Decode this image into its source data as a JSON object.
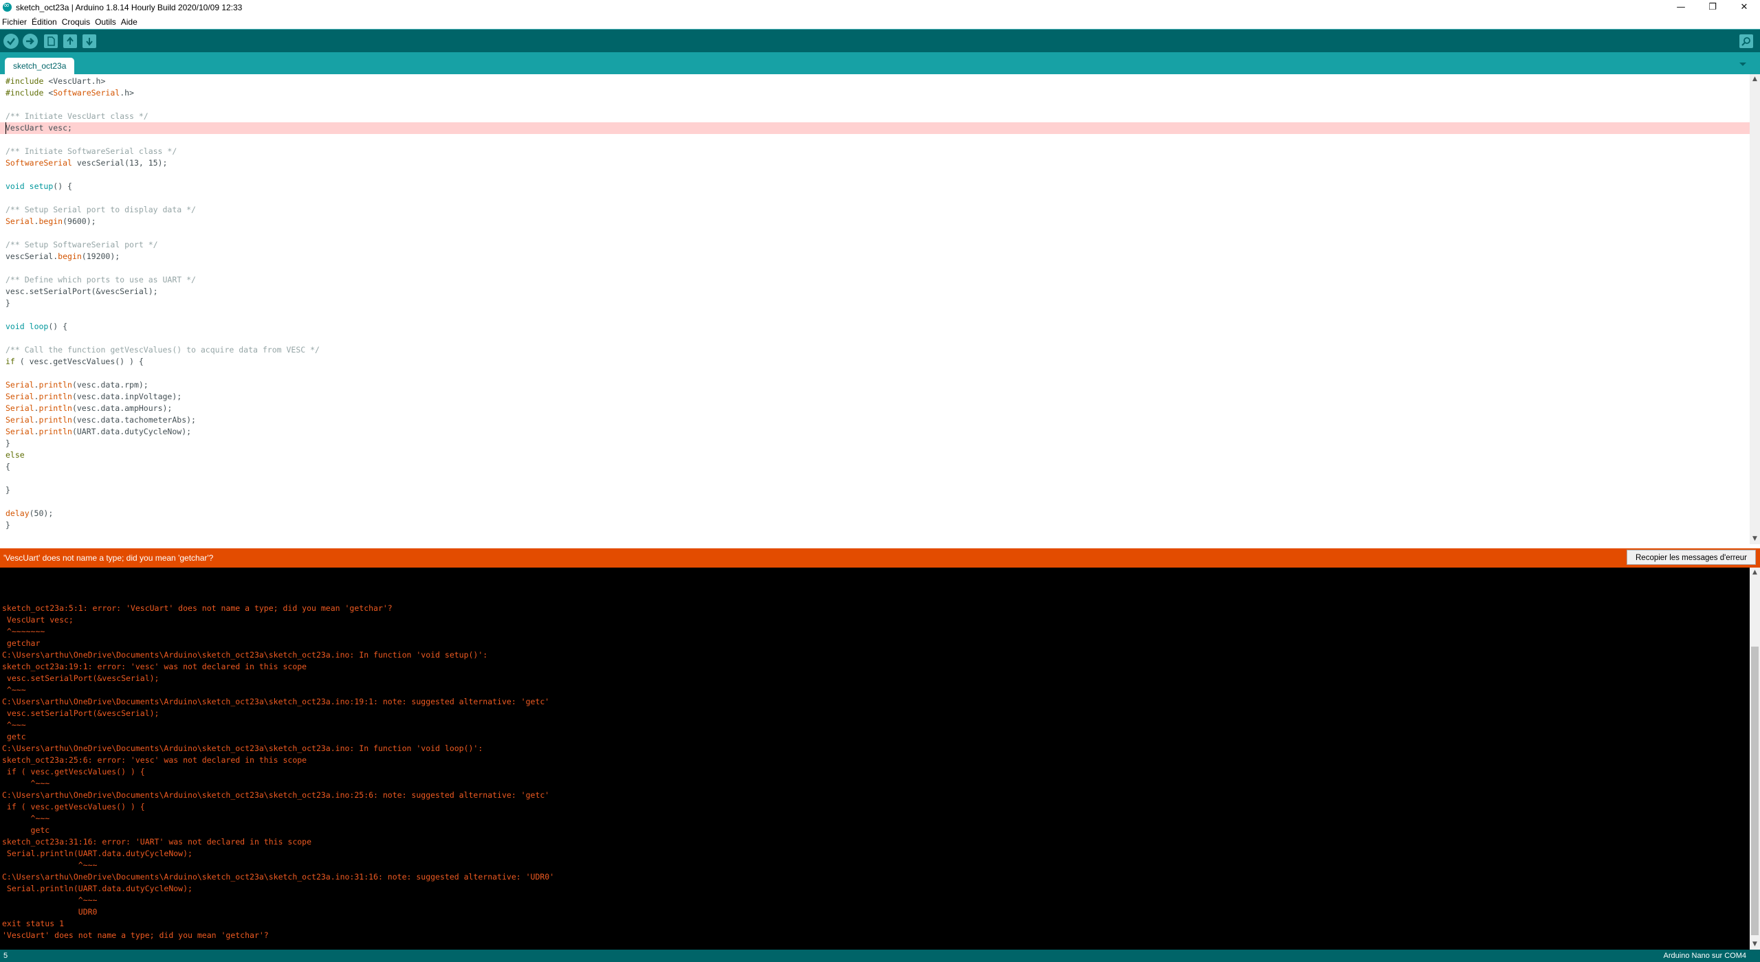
{
  "window": {
    "title": "sketch_oct23a | Arduino 1.8.14 Hourly Build 2020/10/09 12:33",
    "controls": [
      "—",
      "❐",
      "✕"
    ]
  },
  "menu": [
    "Fichier",
    "Édition",
    "Croquis",
    "Outils",
    "Aide"
  ],
  "toolbar": {
    "buttons": [
      "verify-icon",
      "upload-icon",
      "new-icon",
      "open-icon",
      "save-icon"
    ],
    "serial_monitor_icon": "magnifier-icon"
  },
  "tabs": [
    {
      "label": "sketch_oct23a"
    }
  ],
  "colors": {
    "toolbar": "#006468",
    "tabbar": "#17a1a5",
    "error_bar": "#e34c00",
    "console_text": "#ee5a21",
    "highlight": "#ffd1d1"
  },
  "editor": {
    "highlighted_line": 5,
    "lines": [
      {
        "segments": [
          {
            "t": "#include ",
            "c": "pre"
          },
          {
            "t": "<VescUart.h>",
            "c": "inc"
          }
        ]
      },
      {
        "segments": [
          {
            "t": "#include ",
            "c": "pre"
          },
          {
            "t": "<",
            "c": "inc"
          },
          {
            "t": "SoftwareSerial",
            "c": "type"
          },
          {
            "t": ".h>",
            "c": "inc"
          }
        ]
      },
      {
        "segments": []
      },
      {
        "segments": [
          {
            "t": "/** Initiate VescUart class */",
            "c": "com"
          }
        ]
      },
      {
        "segments": [
          {
            "t": "VescUart vesc;",
            "c": "txt"
          }
        ]
      },
      {
        "segments": []
      },
      {
        "segments": [
          {
            "t": "/** Initiate SoftwareSerial class */",
            "c": "com"
          }
        ]
      },
      {
        "segments": [
          {
            "t": "SoftwareSerial",
            "c": "type"
          },
          {
            "t": " vescSerial(13, 15);",
            "c": "txt"
          }
        ]
      },
      {
        "segments": []
      },
      {
        "segments": [
          {
            "t": "void",
            "c": "kw"
          },
          {
            "t": " ",
            "c": "txt"
          },
          {
            "t": "setup",
            "c": "kw"
          },
          {
            "t": "() {",
            "c": "txt"
          }
        ]
      },
      {
        "segments": []
      },
      {
        "segments": [
          {
            "t": "/** Setup Serial port to display data */",
            "c": "com"
          }
        ]
      },
      {
        "segments": [
          {
            "t": "Serial",
            "c": "type"
          },
          {
            "t": ".",
            "c": "txt"
          },
          {
            "t": "begin",
            "c": "type"
          },
          {
            "t": "(9600);",
            "c": "txt"
          }
        ]
      },
      {
        "segments": []
      },
      {
        "segments": [
          {
            "t": "/** Setup SoftwareSerial port */",
            "c": "com"
          }
        ]
      },
      {
        "segments": [
          {
            "t": "vescSerial.",
            "c": "txt"
          },
          {
            "t": "begin",
            "c": "type"
          },
          {
            "t": "(19200);",
            "c": "txt"
          }
        ]
      },
      {
        "segments": []
      },
      {
        "segments": [
          {
            "t": "/** Define which ports to use as UART */",
            "c": "com"
          }
        ]
      },
      {
        "segments": [
          {
            "t": "vesc.setSerialPort(&vescSerial);",
            "c": "txt"
          }
        ]
      },
      {
        "segments": [
          {
            "t": "}",
            "c": "txt"
          }
        ]
      },
      {
        "segments": []
      },
      {
        "segments": [
          {
            "t": "void",
            "c": "kw"
          },
          {
            "t": " ",
            "c": "txt"
          },
          {
            "t": "loop",
            "c": "kw"
          },
          {
            "t": "() {",
            "c": "txt"
          }
        ]
      },
      {
        "segments": []
      },
      {
        "segments": [
          {
            "t": "/** Call the function getVescValues() to acquire data from VESC */",
            "c": "com"
          }
        ]
      },
      {
        "segments": [
          {
            "t": "if",
            "c": "pre"
          },
          {
            "t": " ( vesc.getVescValues() ) {",
            "c": "txt"
          }
        ]
      },
      {
        "segments": []
      },
      {
        "segments": [
          {
            "t": "Serial",
            "c": "type"
          },
          {
            "t": ".",
            "c": "txt"
          },
          {
            "t": "println",
            "c": "type"
          },
          {
            "t": "(vesc.data.rpm);",
            "c": "txt"
          }
        ]
      },
      {
        "segments": [
          {
            "t": "Serial",
            "c": "type"
          },
          {
            "t": ".",
            "c": "txt"
          },
          {
            "t": "println",
            "c": "type"
          },
          {
            "t": "(vesc.data.inpVoltage);",
            "c": "txt"
          }
        ]
      },
      {
        "segments": [
          {
            "t": "Serial",
            "c": "type"
          },
          {
            "t": ".",
            "c": "txt"
          },
          {
            "t": "println",
            "c": "type"
          },
          {
            "t": "(vesc.data.ampHours);",
            "c": "txt"
          }
        ]
      },
      {
        "segments": [
          {
            "t": "Serial",
            "c": "type"
          },
          {
            "t": ".",
            "c": "txt"
          },
          {
            "t": "println",
            "c": "type"
          },
          {
            "t": "(vesc.data.tachometerAbs);",
            "c": "txt"
          }
        ]
      },
      {
        "segments": [
          {
            "t": "Serial",
            "c": "type"
          },
          {
            "t": ".",
            "c": "txt"
          },
          {
            "t": "println",
            "c": "type"
          },
          {
            "t": "(UART.data.dutyCycleNow);",
            "c": "txt"
          }
        ]
      },
      {
        "segments": [
          {
            "t": "}",
            "c": "txt"
          }
        ]
      },
      {
        "segments": [
          {
            "t": "else",
            "c": "pre"
          }
        ]
      },
      {
        "segments": [
          {
            "t": "{",
            "c": "txt"
          }
        ]
      },
      {
        "segments": []
      },
      {
        "segments": [
          {
            "t": "}",
            "c": "txt"
          }
        ]
      },
      {
        "segments": []
      },
      {
        "segments": [
          {
            "t": "delay",
            "c": "type"
          },
          {
            "t": "(50);",
            "c": "txt"
          }
        ]
      },
      {
        "segments": [
          {
            "t": "}",
            "c": "txt"
          }
        ]
      }
    ]
  },
  "error_bar": {
    "message": "'VescUart' does not name a type; did you mean 'getchar'?",
    "copy_button": "Recopier les messages d'erreur"
  },
  "console": {
    "lines": [
      "",
      "",
      "",
      "sketch_oct23a:5:1: error: 'VescUart' does not name a type; did you mean 'getchar'?",
      " VescUart vesc;",
      " ^~~~~~~~",
      " getchar",
      "C:\\Users\\arthu\\OneDrive\\Documents\\Arduino\\sketch_oct23a\\sketch_oct23a.ino: In function 'void setup()':",
      "sketch_oct23a:19:1: error: 'vesc' was not declared in this scope",
      " vesc.setSerialPort(&vescSerial);",
      " ^~~~",
      "C:\\Users\\arthu\\OneDrive\\Documents\\Arduino\\sketch_oct23a\\sketch_oct23a.ino:19:1: note: suggested alternative: 'getc'",
      " vesc.setSerialPort(&vescSerial);",
      " ^~~~",
      " getc",
      "C:\\Users\\arthu\\OneDrive\\Documents\\Arduino\\sketch_oct23a\\sketch_oct23a.ino: In function 'void loop()':",
      "sketch_oct23a:25:6: error: 'vesc' was not declared in this scope",
      " if ( vesc.getVescValues() ) {",
      "      ^~~~",
      "C:\\Users\\arthu\\OneDrive\\Documents\\Arduino\\sketch_oct23a\\sketch_oct23a.ino:25:6: note: suggested alternative: 'getc'",
      " if ( vesc.getVescValues() ) {",
      "      ^~~~",
      "      getc",
      "sketch_oct23a:31:16: error: 'UART' was not declared in this scope",
      " Serial.println(UART.data.dutyCycleNow);",
      "                ^~~~",
      "C:\\Users\\arthu\\OneDrive\\Documents\\Arduino\\sketch_oct23a\\sketch_oct23a.ino:31:16: note: suggested alternative: 'UDR0'",
      " Serial.println(UART.data.dutyCycleNow);",
      "                ^~~~",
      "                UDR0",
      "exit status 1",
      "'VescUart' does not name a type; did you mean 'getchar'?"
    ]
  },
  "status": {
    "line": "5",
    "board": "Arduino Nano sur COM4"
  }
}
